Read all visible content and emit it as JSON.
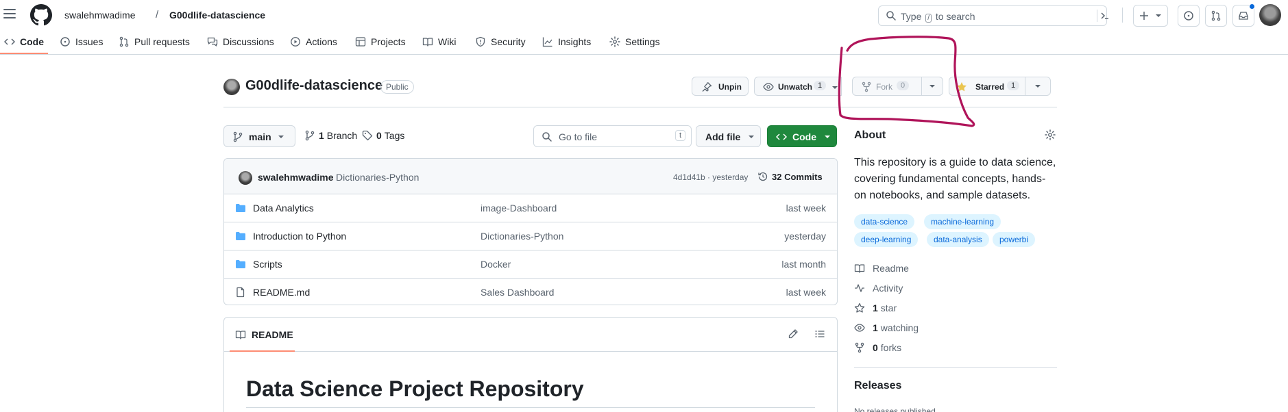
{
  "header": {
    "owner": "swalehmwadime",
    "separator": "/",
    "repo": "G00dlife-datascience",
    "search": {
      "prefix": "Type",
      "key": "/",
      "suffix": "to search"
    }
  },
  "tabs": [
    {
      "label": "Code",
      "icon": "code-icon",
      "active": true
    },
    {
      "label": "Issues",
      "icon": "issue-opened-icon"
    },
    {
      "label": "Pull requests",
      "icon": "git-pull-request-icon"
    },
    {
      "label": "Discussions",
      "icon": "comment-discussion-icon"
    },
    {
      "label": "Actions",
      "icon": "play-icon"
    },
    {
      "label": "Projects",
      "icon": "table-icon"
    },
    {
      "label": "Wiki",
      "icon": "book-icon"
    },
    {
      "label": "Security",
      "icon": "shield-icon"
    },
    {
      "label": "Insights",
      "icon": "graph-icon"
    },
    {
      "label": "Settings",
      "icon": "gear-icon"
    }
  ],
  "repo_header": {
    "title": "G00dlife-datascience",
    "visibility": "Public",
    "unpin": "Unpin",
    "unwatch": "Unwatch",
    "watch_count": "1",
    "fork": "Fork",
    "fork_count": "0",
    "starred": "Starred",
    "star_count": "1"
  },
  "branch_bar": {
    "branch": "main",
    "branches_count": "1",
    "branches_label": "Branch",
    "tags_count": "0",
    "tags_label": "Tags",
    "goto_placeholder": "Go to file",
    "goto_key": "t",
    "add_file": "Add file",
    "code": "Code"
  },
  "commit": {
    "author": "swalehmwadime",
    "message": "Dictionaries-Python",
    "meta": "4d1d41b · yesterday",
    "count_label": "32 Commits"
  },
  "files": [
    {
      "type": "folder",
      "name": "Data Analytics",
      "message": "image-Dashboard",
      "time": "last week"
    },
    {
      "type": "folder",
      "name": "Introduction to Python",
      "message": "Dictionaries-Python",
      "time": "yesterday"
    },
    {
      "type": "folder",
      "name": "Scripts",
      "message": "Docker",
      "time": "last month"
    },
    {
      "type": "file",
      "name": "README.md",
      "message": "Sales Dashboard",
      "time": "last week"
    }
  ],
  "readme": {
    "tab": "README",
    "heading": "Data Science Project Repository"
  },
  "about": {
    "title": "About",
    "description": "This repository is a guide to data science, covering fundamental concepts, hands-on notebooks, and sample datasets.",
    "topics": [
      "data-science",
      "machine-learning",
      "deep-learning",
      "data-analysis",
      "powerbi"
    ],
    "links": [
      {
        "icon": "book-icon",
        "strong": "",
        "label": "Readme"
      },
      {
        "icon": "pulse-icon",
        "strong": "",
        "label": "Activity"
      },
      {
        "icon": "star-icon",
        "strong": "1",
        "label": "star"
      },
      {
        "icon": "eye-icon",
        "strong": "1",
        "label": "watching"
      },
      {
        "icon": "repo-forked-icon",
        "strong": "0",
        "label": "forks"
      }
    ]
  },
  "releases": {
    "title": "Releases",
    "subtitle": "No releases published"
  },
  "colors": {
    "accent_blue": "#0969da",
    "code_button_green": "#1f883d",
    "tab_underline": "#fd8c73",
    "star_yellow": "#eac54f",
    "annotation_magenta": "#b0145a",
    "folder_blue": "#54aeff"
  }
}
